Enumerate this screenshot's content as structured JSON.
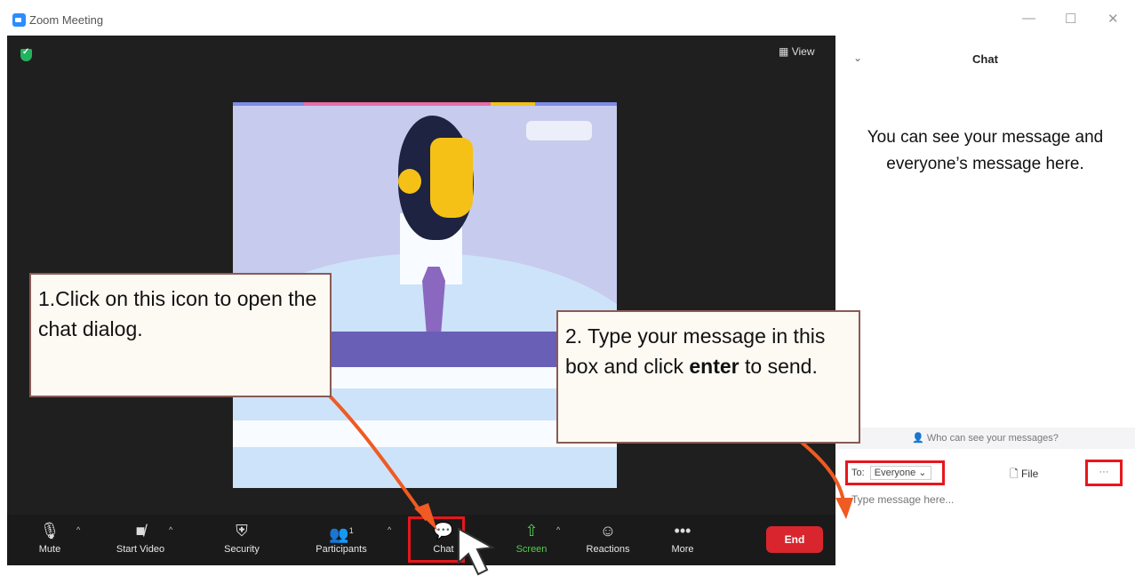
{
  "window": {
    "title": "Zoom Meeting",
    "controls": [
      "—",
      "☐",
      "✕"
    ]
  },
  "meeting": {
    "view_label": "View"
  },
  "toolbar": {
    "mute": "Mute",
    "start_video": "Start Video",
    "security": "Security",
    "participants": "Participants",
    "participants_count": "1",
    "chat": "Chat",
    "share_screen": "Screen",
    "reactions": "Reactions",
    "more": "More",
    "end": "End"
  },
  "chat_panel": {
    "title": "Chat",
    "info": "You can see your message and everyone’s message here.",
    "who_can_see": "Who can see your messages?",
    "to_label": "To:",
    "to_value": "Everyone",
    "file_label": "File",
    "more_label": "···",
    "input_placeholder": "Type message here..."
  },
  "callouts": {
    "step1": "1.Click on this icon to open the chat dialog.",
    "step2_prefix": "2. Type your message in this box and click ",
    "step2_bold": "enter",
    "step2_suffix": " to send."
  },
  "colors": {
    "highlight": "#e8161c",
    "arrow": "#f05a23",
    "end_button": "#d9262e",
    "zoom_blue": "#2d8cff",
    "share_green": "#22b35e"
  }
}
